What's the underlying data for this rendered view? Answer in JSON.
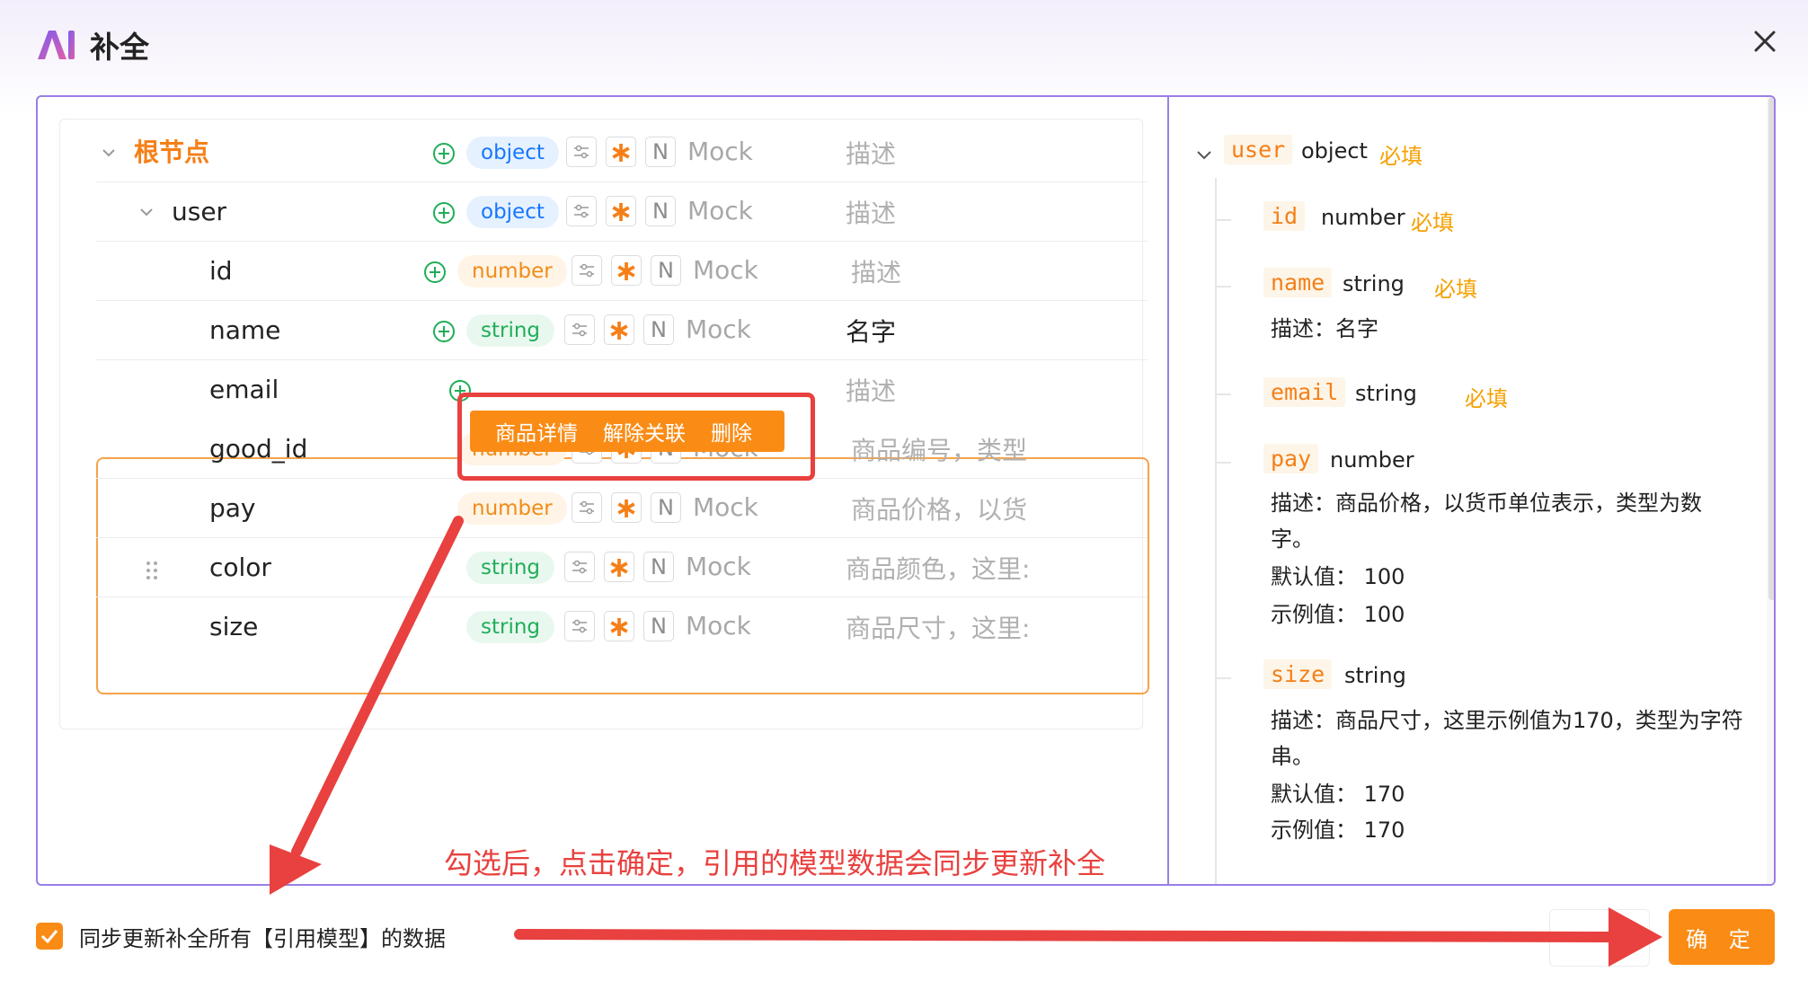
{
  "dialog": {
    "title": "补全",
    "confirm_label": "确 定"
  },
  "tree": {
    "rows": [
      {
        "name": "根节点",
        "type": "object",
        "mock": "Mock",
        "desc": "描述"
      },
      {
        "name": "user",
        "type": "object",
        "mock": "Mock",
        "desc": "描述"
      },
      {
        "name": "id",
        "type": "number",
        "mock": "Mock",
        "desc": "描述"
      },
      {
        "name": "name",
        "type": "string",
        "mock": "Mock",
        "desc": "名字"
      },
      {
        "name": "email",
        "type": "",
        "mock": "",
        "desc": "描述"
      },
      {
        "name": "good_id",
        "type": "number",
        "mock": "Mock",
        "desc": "商品编号，类型"
      },
      {
        "name": "pay",
        "type": "number",
        "mock": "Mock",
        "desc": "商品价格，以货"
      },
      {
        "name": "color",
        "type": "string",
        "mock": "Mock",
        "desc": "商品颜色，这里:"
      },
      {
        "name": "size",
        "type": "string",
        "mock": "Mock",
        "desc": "商品尺寸，这里:"
      }
    ],
    "n_label": "N",
    "context_menu": [
      "商品详情",
      "解除关联",
      "删除"
    ]
  },
  "preview": {
    "root_key": "user",
    "root_type": "object",
    "required": "必填",
    "fields": [
      {
        "key": "id",
        "type": "number",
        "required": "必填"
      },
      {
        "key": "name",
        "type": "string",
        "required": "必填",
        "desc": "描述：名字"
      },
      {
        "key": "email",
        "type": "string",
        "required": "必填"
      },
      {
        "key": "pay",
        "type": "number",
        "desc1": "描述：商品价格，以货币单位表示，类型为数",
        "desc2": "字。",
        "default": "默认值：  100",
        "example": "示例值：  100"
      },
      {
        "key": "size",
        "type": "string",
        "desc1": "描述：商品尺寸，这里示例值为170，类型为字符",
        "desc2": "串。",
        "default": "默认值：  170",
        "example": "示例值：  170"
      }
    ]
  },
  "annotation": "勾选后，点击确定，引用的模型数据会同步更新补全",
  "footer": {
    "sync_label": "同步更新补全所有【引用模型】的数据",
    "sync_checked": true
  },
  "colors": {
    "accent": "#fa8c16",
    "frame": "#9a7ee8",
    "annotation_red": "#e8413f"
  }
}
